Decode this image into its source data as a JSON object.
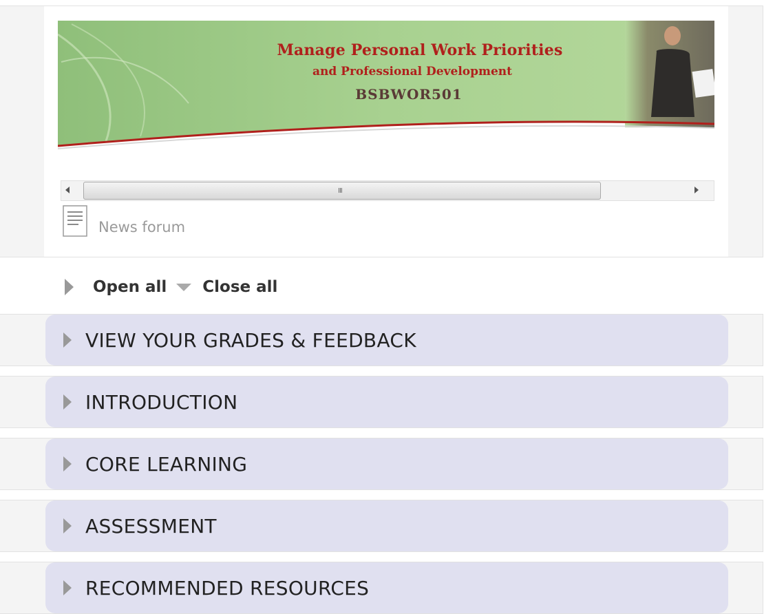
{
  "banner": {
    "line1": "Manage Personal Work Priorities",
    "line2": "and Professional Development",
    "line3": "BSBWOR501"
  },
  "scrollbar": {
    "grip": "III"
  },
  "news_forum": {
    "label": "News forum"
  },
  "toggles": {
    "open_all": "Open all",
    "close_all": "Close all"
  },
  "sections": [
    {
      "title": "VIEW YOUR GRADES & FEEDBACK"
    },
    {
      "title": "INTRODUCTION"
    },
    {
      "title": "CORE LEARNING"
    },
    {
      "title": "ASSESSMENT"
    },
    {
      "title": "RECOMMENDED RESOURCES"
    }
  ],
  "colors": {
    "section_pill": "#e0e0f0",
    "banner_title": "#b0201c",
    "banner_code": "#5a3a36"
  }
}
